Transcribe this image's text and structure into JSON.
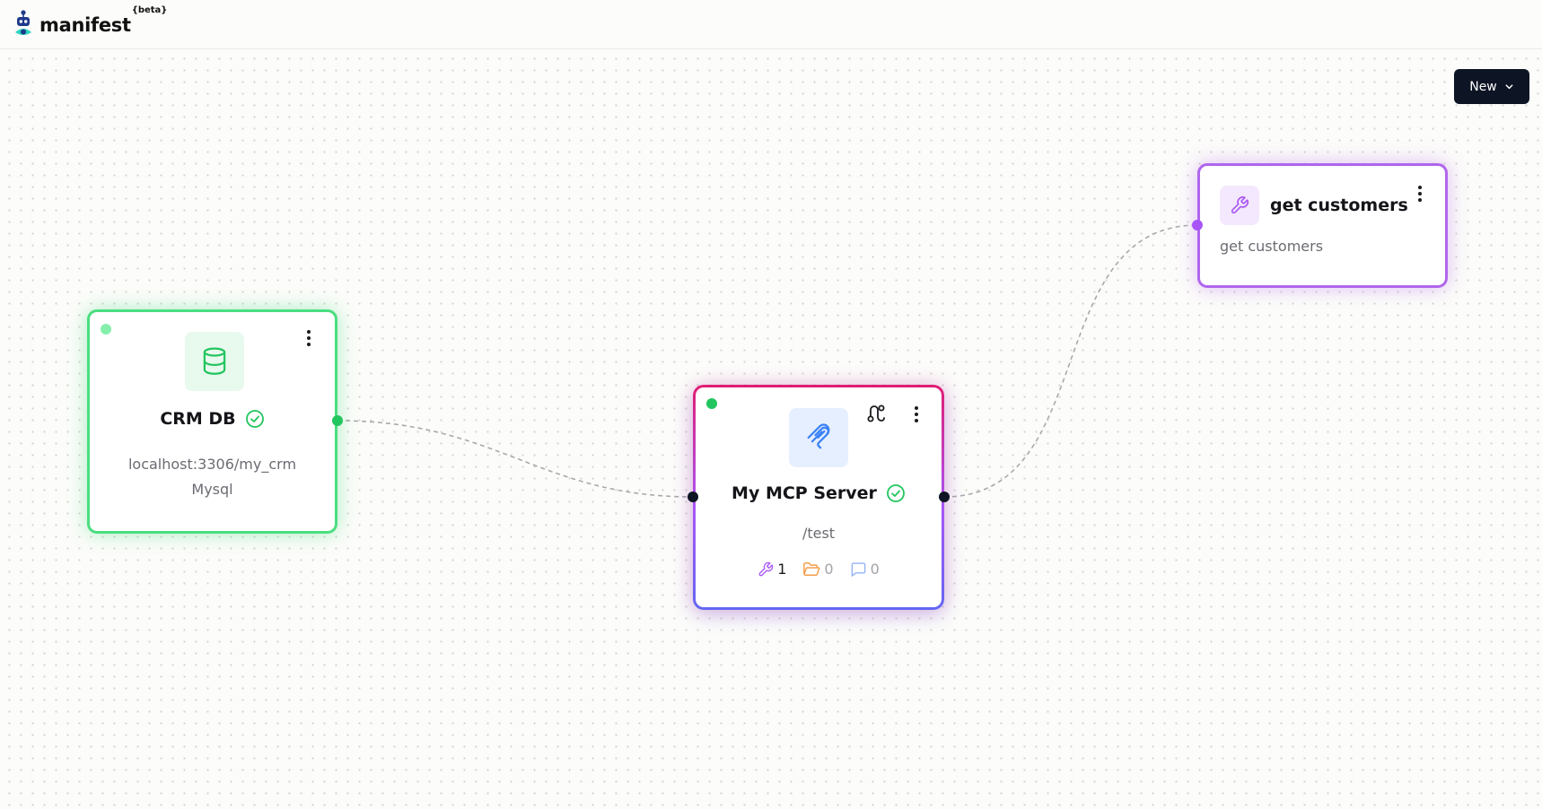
{
  "header": {
    "logo_text": "manifest",
    "logo_badge": "{beta}"
  },
  "toolbar": {
    "new_label": "New"
  },
  "nodes": {
    "db": {
      "title": "CRM DB",
      "host": "localhost:3306/my_crm",
      "engine": "Mysql",
      "icon": "database-icon",
      "status": "connected"
    },
    "server": {
      "title": "My MCP Server",
      "path": "/test",
      "icon": "mcp-icon",
      "status": "connected",
      "counts": {
        "tools": "1",
        "resources": "0",
        "prompts": "0"
      }
    },
    "tool": {
      "title": "get customers",
      "description": "get customers",
      "icon": "wrench-icon"
    }
  },
  "colors": {
    "db_accent": "#4ade80",
    "server_gradient_top": "#e11d74",
    "server_gradient_bottom": "#6366f1",
    "tool_accent": "#b066ec",
    "button_bg": "#0d1424",
    "edge": "#a9a9ae"
  }
}
